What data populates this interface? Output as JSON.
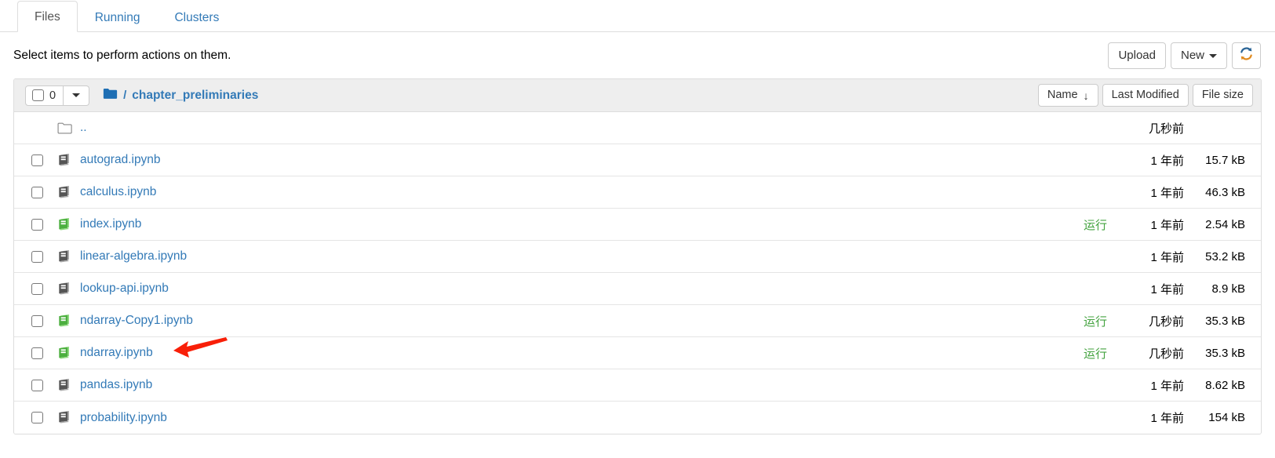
{
  "tabs": [
    {
      "label": "Files",
      "active": true
    },
    {
      "label": "Running",
      "active": false
    },
    {
      "label": "Clusters",
      "active": false
    }
  ],
  "notice": {
    "text": "Select items to perform actions on them.",
    "upload_label": "Upload",
    "new_label": "New",
    "refresh_icon": "refresh-icon"
  },
  "list_header": {
    "selected_count": "0",
    "folder_icon": "folder-icon",
    "path_separator": "/",
    "current_folder": "chapter_preliminaries",
    "sort_name_label": "Name",
    "sort_name_arrow": "↓",
    "sort_modified_label": "Last Modified",
    "sort_size_label": "File size"
  },
  "rows": [
    {
      "name": "..",
      "icon": "folder-open-outline-icon",
      "has_checkbox": false,
      "running": "",
      "modified": "几秒前",
      "size": ""
    },
    {
      "name": "autograd.ipynb",
      "icon": "notebook-icon",
      "has_checkbox": true,
      "running": "",
      "modified": "1 年前",
      "size": "15.7 kB"
    },
    {
      "name": "calculus.ipynb",
      "icon": "notebook-icon",
      "has_checkbox": true,
      "running": "",
      "modified": "1 年前",
      "size": "46.3 kB"
    },
    {
      "name": "index.ipynb",
      "icon": "notebook-running-icon",
      "has_checkbox": true,
      "running": "运行",
      "modified": "1 年前",
      "size": "2.54 kB"
    },
    {
      "name": "linear-algebra.ipynb",
      "icon": "notebook-icon",
      "has_checkbox": true,
      "running": "",
      "modified": "1 年前",
      "size": "53.2 kB"
    },
    {
      "name": "lookup-api.ipynb",
      "icon": "notebook-icon",
      "has_checkbox": true,
      "running": "",
      "modified": "1 年前",
      "size": "8.9 kB"
    },
    {
      "name": "ndarray-Copy1.ipynb",
      "icon": "notebook-running-icon",
      "has_checkbox": true,
      "running": "运行",
      "modified": "几秒前",
      "size": "35.3 kB"
    },
    {
      "name": "ndarray.ipynb",
      "icon": "notebook-running-icon",
      "has_checkbox": true,
      "running": "运行",
      "modified": "几秒前",
      "size": "35.3 kB"
    },
    {
      "name": "pandas.ipynb",
      "icon": "notebook-icon",
      "has_checkbox": true,
      "running": "",
      "modified": "1 年前",
      "size": "8.62 kB"
    },
    {
      "name": "probability.ipynb",
      "icon": "notebook-icon",
      "has_checkbox": true,
      "running": "",
      "modified": "1 年前",
      "size": "154 kB"
    }
  ],
  "annotation": {
    "type": "arrow",
    "color": "#f81f08",
    "points_at": "ndarray.ipynb"
  },
  "colors": {
    "link": "#337ab7",
    "running_green": "#44a340",
    "folder_blue": "#1f6fb4",
    "header_bg": "#eeeeee",
    "border": "#dddddd"
  }
}
